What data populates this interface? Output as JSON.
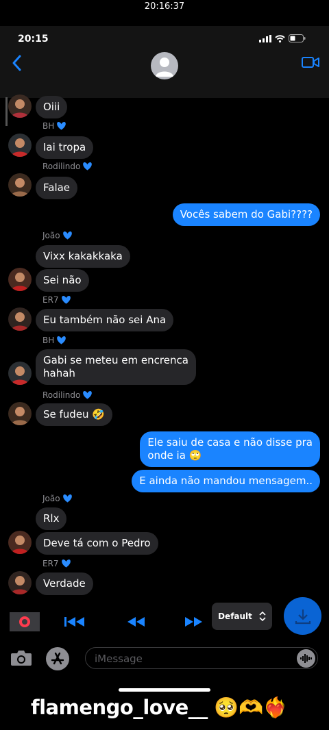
{
  "recording_clock": "20:16:37",
  "status_bar": {
    "time": "20:15"
  },
  "icons": {
    "back": "chevron-left-icon",
    "video": "video-camera-icon",
    "camera": "camera-icon",
    "appstore": "app-store-icon",
    "audio": "audio-waveform-icon",
    "heart": "blue-heart-emoji"
  },
  "messages": [
    {
      "sender": "",
      "text": "Oiii",
      "avatar": "p1",
      "mine": false
    },
    {
      "sender": "BH",
      "text": "Iai tropa",
      "avatar": "p2",
      "mine": false
    },
    {
      "sender": "Rodilindo",
      "text": "Falae",
      "avatar": "p3",
      "mine": false
    },
    {
      "sender": "",
      "text": "Vocês sabem do Gabi????",
      "mine": true
    },
    {
      "sender": "João",
      "text": "Vixx kakakkaka",
      "mine": false
    },
    {
      "sender": "",
      "text": "Sei não",
      "avatar": "p4",
      "mine": false
    },
    {
      "sender": "ER7",
      "text": "Eu também não sei Ana",
      "avatar": "p5",
      "mine": false
    },
    {
      "sender": "BH",
      "text": "Gabi se meteu em encrenca\nhahah",
      "avatar": "p2",
      "mine": false
    },
    {
      "sender": "Rodilindo",
      "text": "Se fudeu 🤣",
      "avatar": "p3",
      "mine": false
    },
    {
      "sender": "",
      "text": "Ele saiu de casa e não disse pra\nonde ia 🙄",
      "mine": true
    },
    {
      "sender": "",
      "text": "E ainda não mandou mensagem..",
      "mine": true
    },
    {
      "sender": "João",
      "text": "Rlx",
      "mine": false
    },
    {
      "sender": "",
      "text": "Deve tá com o Pedro",
      "avatar": "p4",
      "mine": false
    },
    {
      "sender": "ER7",
      "text": "Verdade",
      "avatar": "p5",
      "mine": false
    }
  ],
  "player": {
    "speed_label": "Default"
  },
  "composer": {
    "placeholder": "iMessage"
  },
  "watermark": "flamengo_love__ 🥺🫶❤️‍🔥",
  "colors": {
    "bubble_mine": "#1a84ff",
    "bubble_theirs": "#262629",
    "accent": "#1a84ff"
  }
}
